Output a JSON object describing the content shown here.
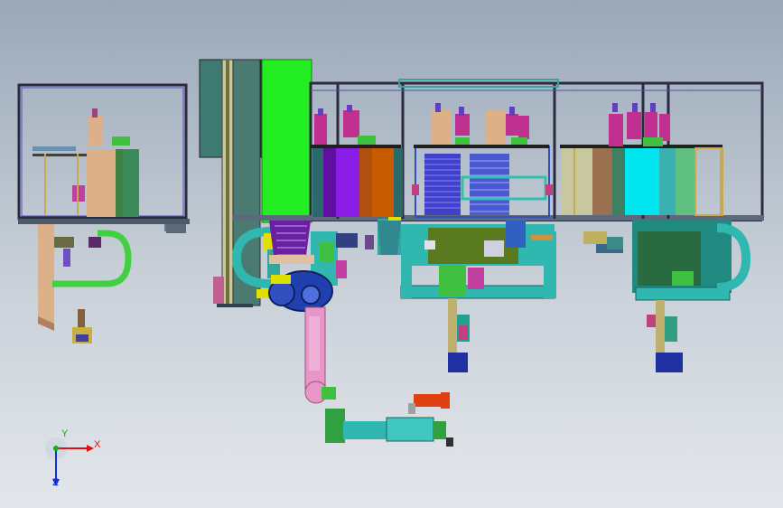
{
  "viewport": {
    "background_top": "#9aa8b9",
    "background_bottom": "#e3e7ec"
  },
  "triad": {
    "x_label": "X",
    "y_label": "Y",
    "z_label": "Z",
    "x_color": "#e01010",
    "y_color": "#10b010",
    "z_color": "#1030d0"
  },
  "colors": {
    "frame": "#2a2a40",
    "green_panel": "#22ee22",
    "teal_panel": "#3f7a72",
    "cyan": "#00e6ee",
    "purple": "#8a1ee6",
    "orange": "#c85a00",
    "robot_pink": "#e896c8",
    "robot_blue": "#2040b0",
    "base_teal": "#30b8b0",
    "tan": "#dcb088",
    "guide_green": "#40d040",
    "red_part": "#e04010"
  }
}
